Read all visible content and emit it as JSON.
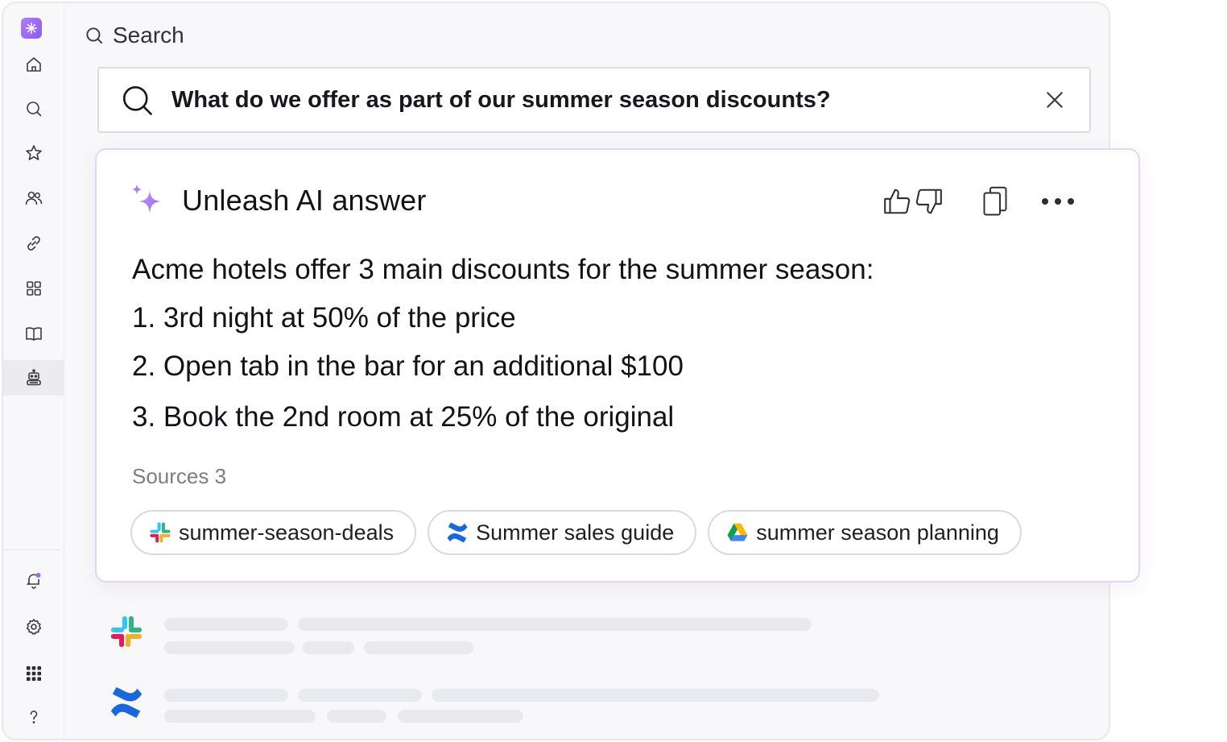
{
  "sidebar": {
    "logo_icon": "unleash-logo",
    "items": [
      {
        "name": "home",
        "icon": "home-icon"
      },
      {
        "name": "search",
        "icon": "search-icon"
      },
      {
        "name": "favorites",
        "icon": "star-icon"
      },
      {
        "name": "people",
        "icon": "users-icon"
      },
      {
        "name": "links",
        "icon": "link-icon"
      },
      {
        "name": "apps",
        "icon": "grid-icon"
      },
      {
        "name": "knowledge",
        "icon": "book-icon"
      },
      {
        "name": "assistant",
        "icon": "robot-icon",
        "active": true
      }
    ],
    "bottom_items": [
      {
        "name": "notifications",
        "icon": "bell-icon"
      },
      {
        "name": "settings",
        "icon": "gear-icon"
      },
      {
        "name": "app-launcher",
        "icon": "apps-grid-icon"
      },
      {
        "name": "help",
        "icon": "help-icon"
      }
    ]
  },
  "header": {
    "search_label": "Search"
  },
  "search": {
    "query": "What do we offer as part of our summer season discounts?"
  },
  "answer": {
    "title": "Unleash AI answer",
    "lines": [
      "Acme hotels offer 3 main discounts for the summer season:",
      "1. 3rd night at 50% of the price",
      "2. Open tab in the bar for an additional $100",
      "3. Book the 2nd room at 25% of the original"
    ],
    "sources_label": "Sources",
    "sources_count": "3",
    "sources": [
      {
        "label": "summer-season-deals",
        "icon": "slack-icon"
      },
      {
        "label": "Summer sales guide",
        "icon": "confluence-icon"
      },
      {
        "label": "summer season planning",
        "icon": "google-drive-icon"
      }
    ]
  },
  "results": [
    {
      "icon": "slack-icon"
    },
    {
      "icon": "confluence-icon"
    }
  ],
  "colors": {
    "accent": "#9b6cf3",
    "card_border": "#e4d4f8",
    "background": "#f8f8fa"
  }
}
